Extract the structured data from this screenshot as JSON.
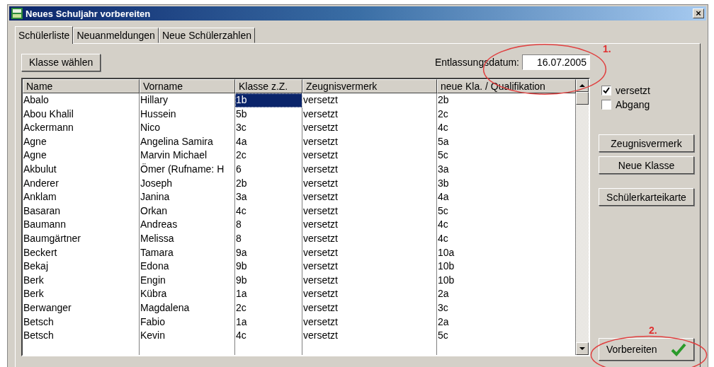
{
  "window": {
    "title": "Neues Schuljahr vorbereiten",
    "close": "×"
  },
  "tabs": [
    {
      "label": "Schülerliste",
      "selected": true
    },
    {
      "label": "Neuanmeldungen",
      "selected": false
    },
    {
      "label": "Neue Schülerzahlen",
      "selected": false
    }
  ],
  "choose_class_button": "Klasse wählen",
  "date_field": {
    "label": "Entlassungsdatum:",
    "value": "16.07.2005"
  },
  "table": {
    "columns": [
      "Name",
      "Vorname",
      "Klasse z.Z.",
      "Zeugnisvermerk",
      "neue Kla. / Qualifikation"
    ],
    "rows": [
      {
        "cells": [
          "Abalo",
          "Hillary",
          "1b",
          "versetzt",
          "2b"
        ],
        "selected": true
      },
      {
        "cells": [
          "Abou Khalil",
          "Hussein",
          "5b",
          "versetzt",
          "2c"
        ],
        "selected": false
      },
      {
        "cells": [
          "Ackermann",
          "Nico",
          "3c",
          "versetzt",
          "4c"
        ],
        "selected": false
      },
      {
        "cells": [
          "Agne",
          "Angelina Samira",
          "4a",
          "versetzt",
          "5a"
        ],
        "selected": false
      },
      {
        "cells": [
          "Agne",
          "Marvin Michael",
          "2c",
          "versetzt",
          "5c"
        ],
        "selected": false
      },
      {
        "cells": [
          "Akbulut",
          "Ömer (Rufname: H",
          "6",
          "versetzt",
          "3a"
        ],
        "selected": false
      },
      {
        "cells": [
          "Anderer",
          "Joseph",
          "2b",
          "versetzt",
          "3b"
        ],
        "selected": false
      },
      {
        "cells": [
          "Anklam",
          "Janina",
          "3a",
          "versetzt",
          "4a"
        ],
        "selected": false
      },
      {
        "cells": [
          "Basaran",
          "Orkan",
          "4c",
          "versetzt",
          "5c"
        ],
        "selected": false
      },
      {
        "cells": [
          "Baumann",
          "Andreas",
          "8",
          "versetzt",
          "4c"
        ],
        "selected": false
      },
      {
        "cells": [
          "Baumgärtner",
          "Melissa",
          "8",
          "versetzt",
          "4c"
        ],
        "selected": false
      },
      {
        "cells": [
          "Beckert",
          "Tamara",
          "9a",
          "versetzt",
          "10a"
        ],
        "selected": false
      },
      {
        "cells": [
          "Bekaj",
          "Edona",
          "9b",
          "versetzt",
          "10b"
        ],
        "selected": false
      },
      {
        "cells": [
          "Berk",
          "Engin",
          "9b",
          "versetzt",
          "10b"
        ],
        "selected": false
      },
      {
        "cells": [
          "Berk",
          "Kübra",
          "1a",
          "versetzt",
          "2a"
        ],
        "selected": false
      },
      {
        "cells": [
          "Berwanger",
          "Magdalena",
          "2c",
          "versetzt",
          "3c"
        ],
        "selected": false
      },
      {
        "cells": [
          "Betsch",
          "Fabio",
          "1a",
          "versetzt",
          "2a"
        ],
        "selected": false
      },
      {
        "cells": [
          "Betsch",
          "Kevin",
          "4c",
          "versetzt",
          "5c"
        ],
        "selected": false
      }
    ]
  },
  "checkboxes": [
    {
      "label": "versetzt",
      "checked": true
    },
    {
      "label": "Abgang",
      "checked": false
    }
  ],
  "side_buttons": [
    "Zeugnisvermerk",
    "Neue Klasse",
    "Schülerkarteikarte"
  ],
  "prepare_button": "Vorbereiten",
  "annotations": [
    {
      "label": "1."
    },
    {
      "label": "2."
    }
  ]
}
